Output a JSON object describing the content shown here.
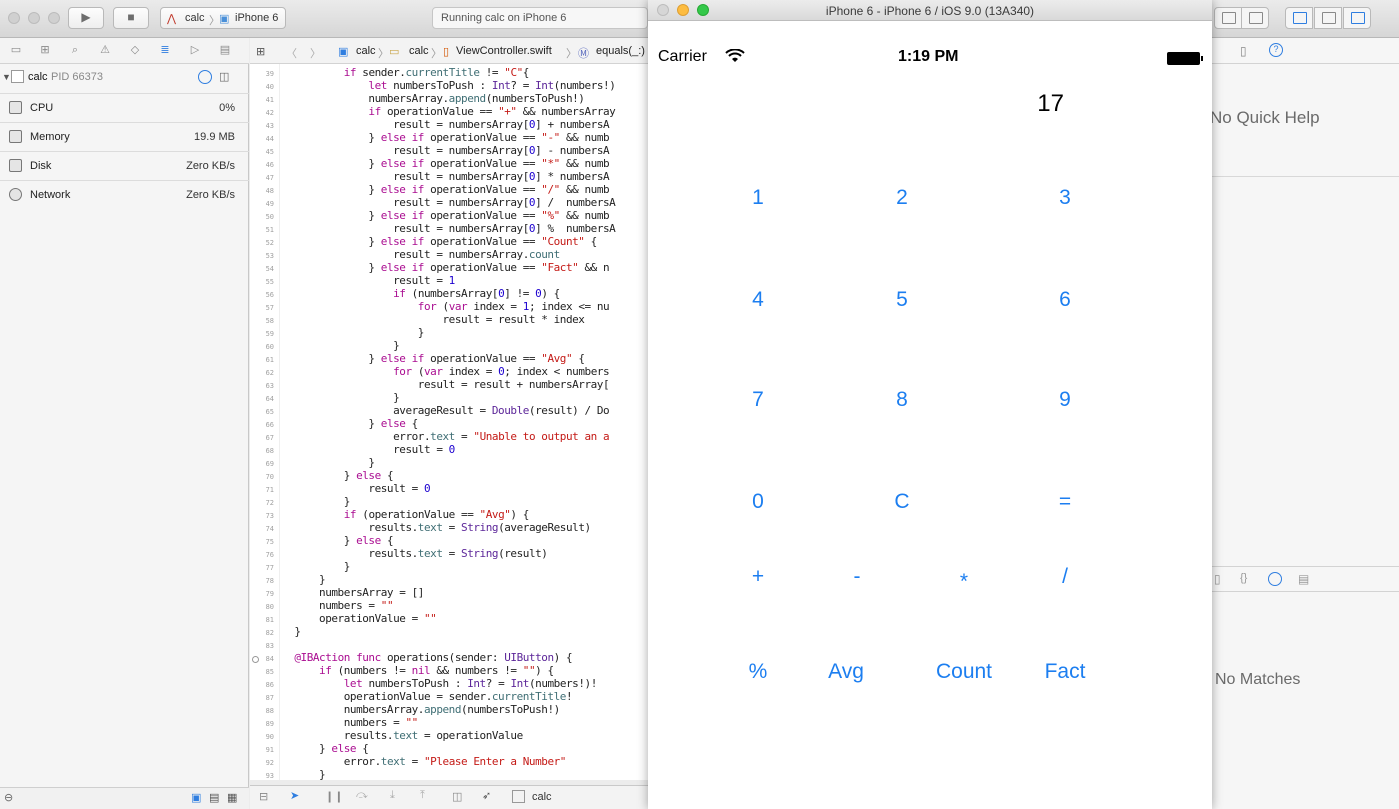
{
  "xcode": {
    "toolbar": {
      "scheme_project": "calc",
      "scheme_device": "iPhone 6",
      "activity_text": "Running calc on iPhone 6"
    },
    "debug_navigator": {
      "process_name": "calc",
      "process_pid": "PID 66373",
      "gauges": [
        {
          "name": "CPU",
          "value": "0%"
        },
        {
          "name": "Memory",
          "value": "19.9 MB"
        },
        {
          "name": "Disk",
          "value": "Zero KB/s"
        },
        {
          "name": "Network",
          "value": "Zero KB/s"
        }
      ]
    },
    "jumpbar": {
      "items": [
        "calc",
        "calc",
        "ViewController.swift",
        "equals(_:)"
      ]
    },
    "debugbar": {
      "target_label": "calc"
    },
    "utilities": {
      "quick_help_empty": "No Quick Help",
      "library_empty": "No Matches"
    }
  },
  "simulator": {
    "window_title": "iPhone 6 - iPhone 6 / iOS 9.0 (13A340)",
    "status_bar": {
      "carrier": "Carrier",
      "time": "1:19 PM"
    },
    "app": {
      "display_value": "17",
      "buttons": {
        "digit_1": "1",
        "digit_2": "2",
        "digit_3": "3",
        "digit_4": "4",
        "digit_5": "5",
        "digit_6": "6",
        "digit_7": "7",
        "digit_8": "8",
        "digit_9": "9",
        "digit_0": "0",
        "clear": "C",
        "equals": "=",
        "plus": "+",
        "minus": "-",
        "multiply": "*",
        "divide": "/",
        "modulo": "%",
        "avg": "Avg",
        "count": "Count",
        "fact": "Fact"
      }
    }
  },
  "colors": {
    "ios_tint": "#1c7ef0",
    "keyword": "#aa0d91",
    "string": "#c41a16",
    "number": "#1c00cf",
    "type": "#5c2699"
  }
}
